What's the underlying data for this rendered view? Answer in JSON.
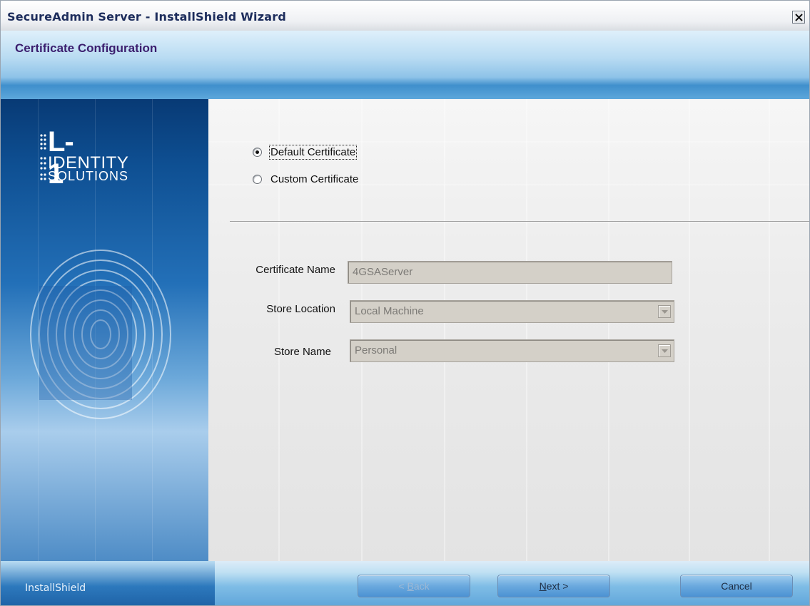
{
  "window": {
    "title": "SecureAdmin Server - InstallShield Wizard",
    "close_symbol": "×"
  },
  "header": {
    "title": "Certificate Configuration"
  },
  "banner": {
    "logo_mark": "L-1",
    "logo_line1": "IDENTITY",
    "logo_line2": "SOLUTIONS",
    "logo_icon": "fingerprint-icon"
  },
  "certificate_type": {
    "options": [
      {
        "label": "Default Certificate",
        "selected": true
      },
      {
        "label": "Custom Certificate",
        "selected": false
      }
    ]
  },
  "fields": {
    "certificate_name": {
      "label": "Certificate Name",
      "value": "4GSAServer"
    },
    "store_location": {
      "label": "Store Location",
      "value": "Local Machine"
    },
    "store_name": {
      "label": "Store Name",
      "value": "Personal"
    }
  },
  "footer": {
    "brand": "InstallShield",
    "back_mnemonic": "B",
    "back_rest": "ack",
    "back_prefix": "< ",
    "next_mnemonic": "N",
    "next_rest": "ext >",
    "cancel_label": "Cancel"
  },
  "colors": {
    "title_text": "#1d2d5c",
    "header_title": "#3b1e6e",
    "banner_blue": "#0e4f92",
    "button_blue": "#6aa9de"
  }
}
